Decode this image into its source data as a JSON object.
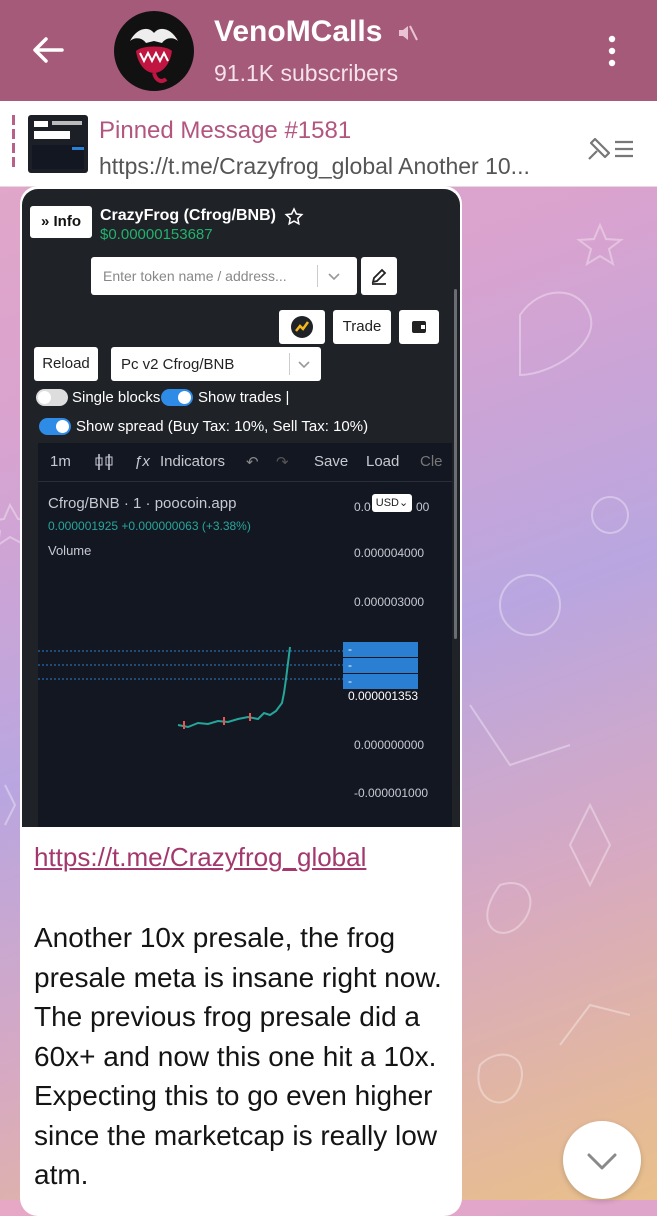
{
  "header": {
    "channel_name": "VenoMCalls",
    "subscribers": "91.1K subscribers"
  },
  "pinned": {
    "title": "Pinned Message #1581",
    "preview": "https://t.me/Crazyfrog_global  Another 10..."
  },
  "screenshot": {
    "info_btn": "» Info",
    "token_name": "CrazyFrog (Cfrog/BNB)",
    "token_price": "$0.00000153687",
    "search_placeholder": "Enter token name / address...",
    "trade_btn": "Trade",
    "reload_btn": "Reload",
    "pair_select": "Pc v2 Cfrog/BNB",
    "single_blocks": "Single blocks",
    "show_trades": "Show trades |",
    "show_spread": "Show spread (Buy Tax: 10%, Sell Tax: 10%)",
    "chart": {
      "interval": "1m",
      "indicators": "Indicators",
      "save": "Save",
      "load": "Load",
      "more": "Cle",
      "symbol": "Cfrog/BNB · 1 · poocoin.app",
      "ohlc": "0.000001925 +0.000000063 (+3.38%)",
      "volume": "Volume",
      "currency": "USD",
      "axis_ticks": [
        "0.0",
        "00",
        "0.000004000",
        "0.000003000",
        "0.000000000",
        "-0.000001000"
      ],
      "price_tags": [
        "- 0.000001925",
        "- 0.000001654",
        "- 0.000001353"
      ]
    }
  },
  "message": {
    "link": "https://t.me/Crazyfrog_global",
    "text": "Another 10x presale, the frog presale meta is insane right now. The previous frog presale did a 60x+ and now this one hit a 10x. Expecting this to go even higher since the marketcap is really low atm."
  },
  "colors": {
    "header": "#a65a79",
    "accent": "#b2557f",
    "link": "#a3386c",
    "price_green": "#23b26d"
  }
}
